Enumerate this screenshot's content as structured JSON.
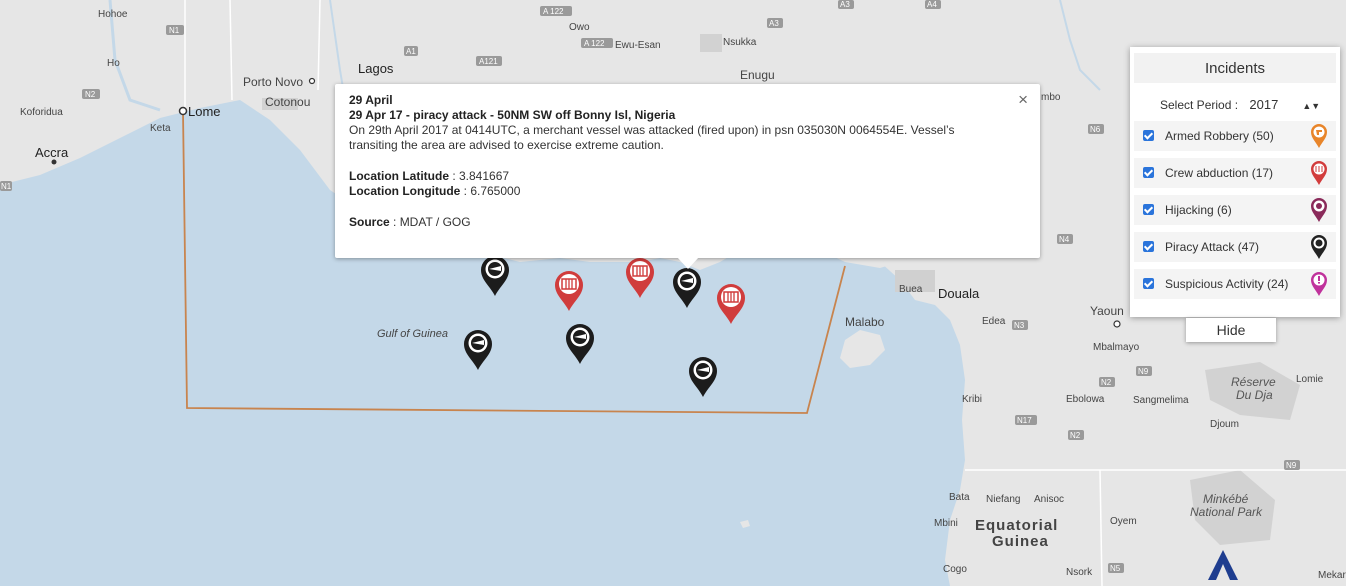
{
  "map": {
    "water_label": "Gulf of Guinea",
    "countries": [
      "Equatorial",
      "Guinea"
    ],
    "cities": [
      {
        "name": "Lagos",
        "size": "lg"
      },
      {
        "name": "Lome",
        "size": "lg"
      },
      {
        "name": "Accra",
        "size": "lg"
      },
      {
        "name": "Douala",
        "size": "lg"
      },
      {
        "name": "Porto Novo",
        "size": "md"
      },
      {
        "name": "Cotonou",
        "size": "md"
      },
      {
        "name": "Enugu",
        "size": "md"
      },
      {
        "name": "Malabo",
        "size": "md"
      },
      {
        "name": "Yaoun",
        "size": "md"
      },
      {
        "name": "Hohoe",
        "size": "sm"
      },
      {
        "name": "Ho",
        "size": "sm"
      },
      {
        "name": "Koforidua",
        "size": "sm"
      },
      {
        "name": "Keta",
        "size": "sm"
      },
      {
        "name": "Owo",
        "size": "sm"
      },
      {
        "name": "Ewu-Esan",
        "size": "sm"
      },
      {
        "name": "Nsukka",
        "size": "sm"
      },
      {
        "name": "Buea",
        "size": "sm"
      },
      {
        "name": "Edea",
        "size": "sm"
      },
      {
        "name": "Mbalmayo",
        "size": "sm"
      },
      {
        "name": "Ebolowa",
        "size": "sm"
      },
      {
        "name": "Sangmelima",
        "size": "sm"
      },
      {
        "name": "Kribi",
        "size": "sm"
      },
      {
        "name": "Djoum",
        "size": "sm"
      },
      {
        "name": "Lomie",
        "size": "sm"
      },
      {
        "name": "Bata",
        "size": "sm"
      },
      {
        "name": "Niefang",
        "size": "sm"
      },
      {
        "name": "Anisoc",
        "size": "sm"
      },
      {
        "name": "Mbini",
        "size": "sm"
      },
      {
        "name": "Oyem",
        "size": "sm"
      },
      {
        "name": "Cogo",
        "size": "sm"
      },
      {
        "name": "Nsork",
        "size": "sm"
      },
      {
        "name": "Mekar",
        "size": "sm"
      },
      {
        "name": "mbo",
        "size": "sm"
      }
    ],
    "parks": [
      "Réserve",
      "Du Dja",
      "Minkébé",
      "National Park"
    ],
    "roads": [
      "N1",
      "N2",
      "N1",
      "A 122",
      "A 122",
      "A121",
      "A1",
      "A3",
      "A4",
      "A3",
      "N6",
      "N4",
      "N3",
      "N2",
      "N9",
      "N17",
      "N2",
      "N9",
      "N5"
    ]
  },
  "popup": {
    "date": "29 April",
    "headline": "29 Apr 17 - piracy attack - 50NM SW off Bonny Isl, Nigeria",
    "description": "On 29th April 2017 at 0414UTC, a merchant vessel was attacked (fired upon) in psn 035030N 0064554E. Vessel’s transiting the area are advised to exercise extreme caution.",
    "lat_label": "Location Latitude",
    "lat_value": " : 3.841667",
    "lon_label": "Location Longitude",
    "lon_value": " : 6.765000",
    "source_label": "Source",
    "source_value": " : MDAT / GOG",
    "close": "×"
  },
  "panel": {
    "title": "Incidents",
    "period_label": "Select Period :",
    "period_value": "2017",
    "items": [
      {
        "label": "Armed Robbery (50)",
        "color": "#e8852a",
        "icon": "gun-icon"
      },
      {
        "label": "Crew abduction (17)",
        "color": "#d23c3c",
        "icon": "cage-icon"
      },
      {
        "label": "Hijacking (6)",
        "color": "#8a2a5a",
        "icon": "hijack-icon"
      },
      {
        "label": "Piracy Attack (47)",
        "color": "#222222",
        "icon": "pirate-icon"
      },
      {
        "label": "Suspicious Activity (24)",
        "color": "#c0329c",
        "icon": "exclamation-icon"
      }
    ],
    "hide_label": "Hide"
  },
  "colors": {
    "sea": "#c4d8e8",
    "land": "#e6e6e6",
    "boundary": "#c8844e"
  }
}
